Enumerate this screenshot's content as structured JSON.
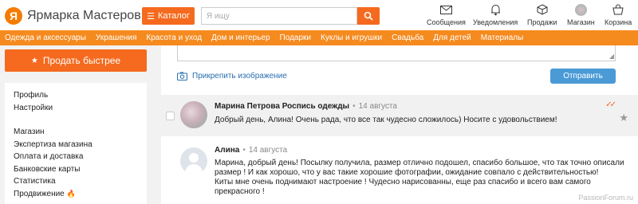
{
  "header": {
    "logo_text": "Ярмарка Мастеров",
    "logo_letter": "Я",
    "catalog_label": "Каталог",
    "search_placeholder": "Я ищу",
    "items": [
      {
        "label": "Сообщения",
        "icon": "envelope-icon"
      },
      {
        "label": "Уведомления",
        "icon": "bell-icon"
      },
      {
        "label": "Продажи",
        "icon": "box-icon"
      },
      {
        "label": "Магазин",
        "icon": "shop-avatar-icon"
      },
      {
        "label": "Корзина",
        "icon": "cart-icon"
      }
    ]
  },
  "nav": [
    "Одежда и аксессуары",
    "Украшения",
    "Красота и уход",
    "Дом и интерьер",
    "Подарки",
    "Куклы и игрушки",
    "Свадьба",
    "Для детей",
    "Материалы"
  ],
  "sidebar": {
    "sell_button": "Продать быстрее",
    "items": [
      "Профиль",
      "Настройки",
      "Магазин",
      "Экспертиза магазина",
      "Оплата и доставка",
      "Банковские карты",
      "Статистика",
      "Продвижение",
      "Продвижение"
    ]
  },
  "composer": {
    "attach_label": "Прикрепить изображение",
    "send_label": "Отправить"
  },
  "messages": [
    {
      "author": "Марина Петрова Роспись одежды",
      "date": "14 августа",
      "text": "Добрый день, Алина! Очень рада, что все так чудесно сложилось) Носите с удовольствием!"
    },
    {
      "author": "Алина",
      "date": "14 августа",
      "lines": [
        "Марина, добрый день! Посылку получила, размер отлично подошел, спасибо большое, что так точно описали",
        "размер ! И как хорошо, что у вас такие хорошие фотографии, ожидание совпало с действительностью!",
        "Киты мне очень поднимают настроение ! Чудесно нарисованны, еще раз спасибо и всего вам самого",
        "прекрасного !"
      ]
    }
  ],
  "watermark": "PassionForum.ru",
  "colors": {
    "accent": "#f56a1e",
    "nav": "#f58a1f",
    "send": "#4a9ad6",
    "link": "#2a6fb0"
  }
}
